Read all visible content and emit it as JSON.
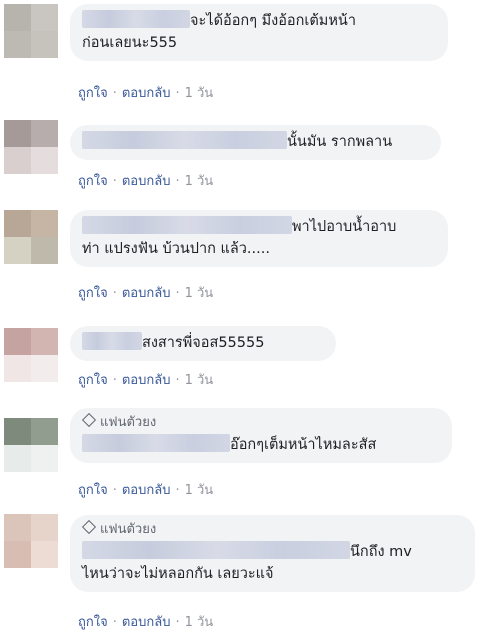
{
  "comments": [
    {
      "lines": [
        "จะได้อ้อกๆ มึงอ้อกเต้มหน้า",
        "ก่อนเลยนะ555"
      ],
      "badge": "",
      "actions": {
        "like": "ถูกใจ",
        "reply": "ตอบกลับ",
        "time": "1 วัน"
      },
      "avatar_colors": [
        "#b7b4ae",
        "#c9c6c1",
        "#aba7a1",
        "#d3d0cb",
        "#bdbab4",
        "#c6c3bd"
      ]
    },
    {
      "lines": [
        "นั้นมัน รากพลาน"
      ],
      "badge": "",
      "actions": {
        "like": "ถูกใจ",
        "reply": "ตอบกลับ",
        "time": "1 วัน"
      },
      "avatar_colors": [
        "#a59a98",
        "#b7adac",
        "#9d9290",
        "#c7bdbc",
        "#d9cfcf",
        "#e5dddd"
      ]
    },
    {
      "lines": [
        "พาไปอาบน้ำอาบ",
        "ท่า แปรงฟัน บ้วนปาก แล้ว....."
      ],
      "badge": "",
      "actions": {
        "like": "ถูกใจ",
        "reply": "ตอบกลับ",
        "time": "1 วัน"
      },
      "avatar_colors": [
        "#b8a696",
        "#c6b5a5",
        "#a5978a",
        "#c9c3b6",
        "#d5d2c4",
        "#bfb9ab"
      ]
    },
    {
      "lines": [
        "สงสารพี่จอส55555"
      ],
      "badge": "",
      "actions": {
        "like": "ถูกใจ",
        "reply": "ตอบกลับ",
        "time": "1 วัน"
      },
      "avatar_colors": [
        "#c5a3a0",
        "#d2b4b1",
        "#b28e8b",
        "#e4d3d1",
        "#efe6e5",
        "#f3ecec"
      ]
    },
    {
      "lines": [
        "อ๊อกๆเต็มหน้าไหมละสัส"
      ],
      "badge": "แฟนตัวยง",
      "actions": {
        "like": "ถูกใจ",
        "reply": "ตอบกลับ",
        "time": "1 วัน"
      },
      "avatar_colors": [
        "#7d8a7c",
        "#909d8f",
        "#6f7c6e",
        "#d9dedb",
        "#e7ebe9",
        "#eef1ef"
      ]
    },
    {
      "lines": [
        "นึกถึง mv",
        "ไหนว่าจะไม่หลอกกัน เลยวะแจ้"
      ],
      "badge": "แฟนตัวยง",
      "actions": {
        "like": "ถูกใจ",
        "reply": "ตอบกลับ",
        "time": "1 วัน"
      },
      "avatar_colors": [
        "#dbc5ba",
        "#e6d3c9",
        "#cfb6aa",
        "#e3cec5",
        "#d7bdb2",
        "#ecdcd4"
      ]
    }
  ]
}
